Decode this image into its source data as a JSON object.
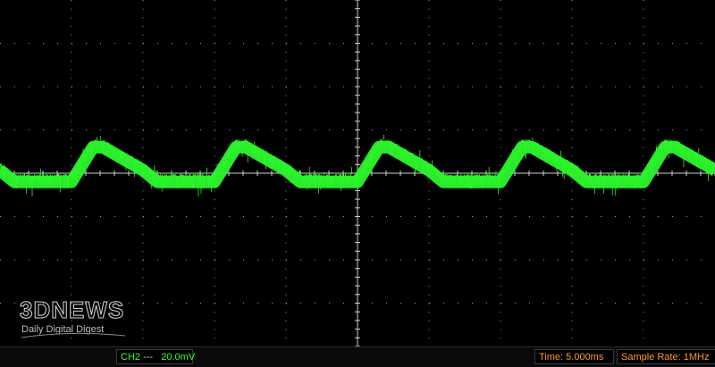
{
  "status": {
    "channel": "CH2",
    "coupling_symbol": "---",
    "volts_per_div": "20.0mV",
    "time_label": "Time:",
    "time_value": "5.000ms",
    "rate_label": "Sample Rate:",
    "rate_value": "1MHz"
  },
  "watermark": {
    "brand": "3DNEWS",
    "tagline": "Daily Digital Digest"
  },
  "colors": {
    "trace": "#2cf52c",
    "grid": "#9a9a9a",
    "status_orange": "#ff9a1e",
    "status_green": "#32ff32"
  },
  "chart_data": {
    "type": "line",
    "grid": {
      "h_divisions": 10,
      "v_divisions": 8
    },
    "series": [
      {
        "name": "CH2",
        "waveform": "periodic triangular ripple with noise",
        "period_ms": 10,
        "time_window_ms": 50,
        "base_level_div": -0.2,
        "peak_level_div": 0.6,
        "noise_div": 0.2
      }
    ]
  }
}
